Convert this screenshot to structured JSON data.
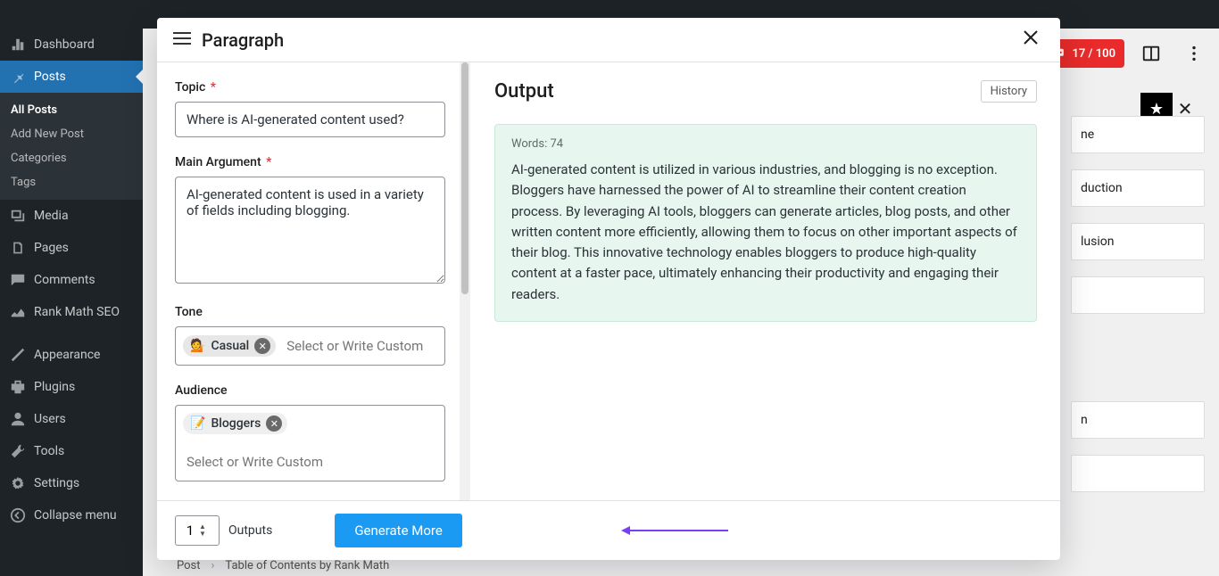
{
  "sidebar": {
    "items": [
      {
        "icon": "dashboard",
        "label": "Dashboard"
      },
      {
        "icon": "pin",
        "label": "Posts",
        "active": true
      },
      {
        "icon": "media",
        "label": "Media"
      },
      {
        "icon": "pages",
        "label": "Pages"
      },
      {
        "icon": "comments",
        "label": "Comments"
      },
      {
        "icon": "rankmath",
        "label": "Rank Math SEO"
      },
      {
        "icon": "appearance",
        "label": "Appearance"
      },
      {
        "icon": "plugins",
        "label": "Plugins"
      },
      {
        "icon": "users",
        "label": "Users"
      },
      {
        "icon": "tools",
        "label": "Tools"
      },
      {
        "icon": "settings",
        "label": "Settings"
      },
      {
        "icon": "collapse",
        "label": "Collapse menu"
      }
    ],
    "submenu": [
      "All Posts",
      "Add New Post",
      "Categories",
      "Tags"
    ]
  },
  "modal": {
    "title": "Paragraph",
    "form": {
      "topic_label": "Topic",
      "topic_value": "Where is AI-generated content used?",
      "argument_label": "Main Argument",
      "argument_value": "AI-generated content is used in a variety of fields including blogging.",
      "tone_label": "Tone",
      "tone_chip_emoji": "💁",
      "tone_chip_label": "Casual",
      "tone_placeholder": "Select or Write Custom",
      "audience_label": "Audience",
      "audience_chip_emoji": "📝",
      "audience_chip_label": "Bloggers",
      "audience_placeholder": "Select or Write Custom"
    },
    "output": {
      "heading": "Output",
      "history_btn": "History",
      "word_count_label": "Words: 74",
      "body": "AI-generated content is utilized in various industries, and blogging is no exception. Bloggers have harnessed the power of AI to streamline their content creation process. By leveraging AI tools, bloggers can generate articles, blog posts, and other written content more efficiently, allowing them to focus on other important aspects of their blog. This innovative technology enables bloggers to produce high-quality content at a faster pace, ultimately enhancing their productivity and engaging their readers."
    },
    "footer": {
      "count_value": "1",
      "outputs_label": "Outputs",
      "generate_label": "Generate More"
    }
  },
  "topbar": {
    "credits": "17 / 100"
  },
  "right_panel_fragments": [
    "ne",
    "duction",
    "lusion",
    "",
    "n",
    ""
  ],
  "breadcrumb": {
    "a": "Post",
    "b": "Table of Contents by Rank Math"
  }
}
